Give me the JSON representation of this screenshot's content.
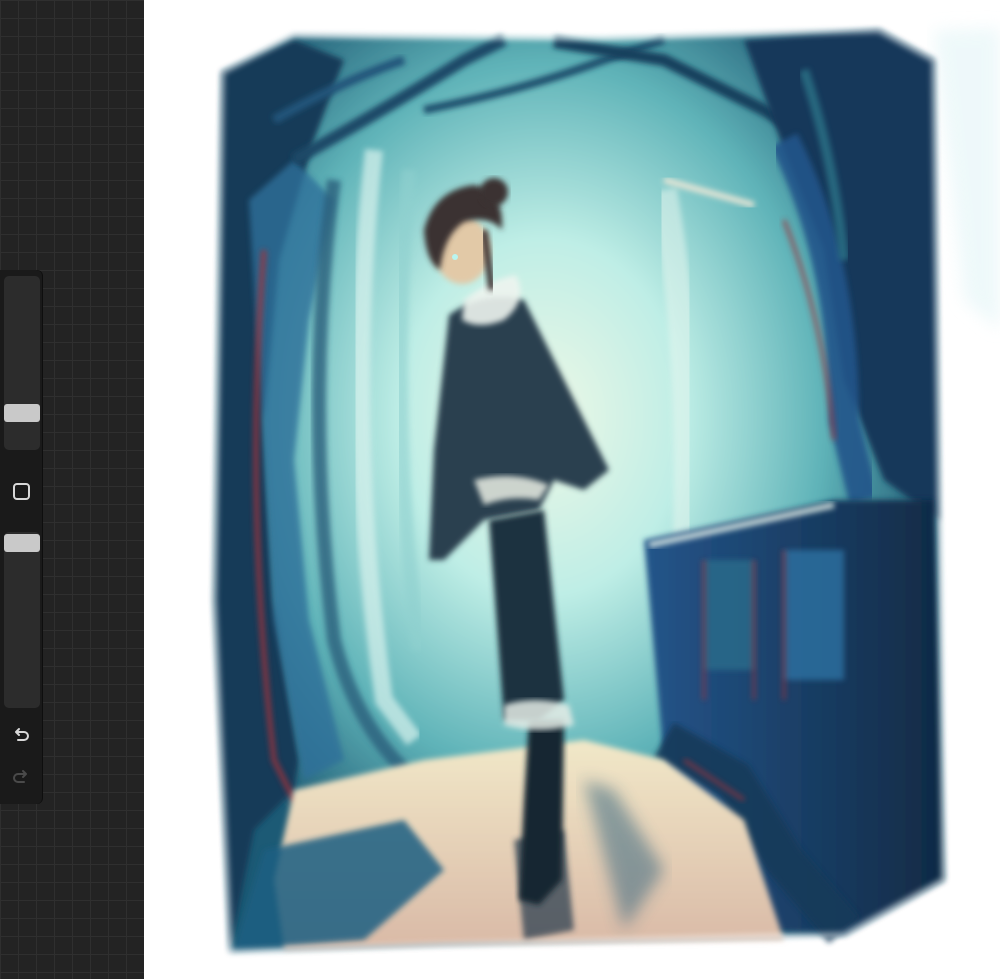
{
  "app": {
    "canvas": {
      "artwork_label": "",
      "colors": {
        "deep_navy": "#15344d",
        "teal": "#2f7b8e",
        "glow": "#cdf3ec",
        "warm_light": "#efe3c4",
        "accent_red": "#a0303a"
      }
    },
    "sidebar": {
      "brush_size": {
        "icon": "slider-thumb",
        "level": 0.23
      },
      "modify_button": {
        "icon": "square-icon"
      },
      "opacity": {
        "icon": "slider-thumb",
        "level": 0.97
      },
      "undo": {
        "icon": "undo-arrow-icon",
        "enabled": true
      },
      "redo": {
        "icon": "redo-arrow-icon",
        "enabled": false
      }
    },
    "colors": {
      "panel_background": "#232323",
      "sidebar_background": "#1a1a1a",
      "thumb": "#c9c9c9"
    }
  }
}
